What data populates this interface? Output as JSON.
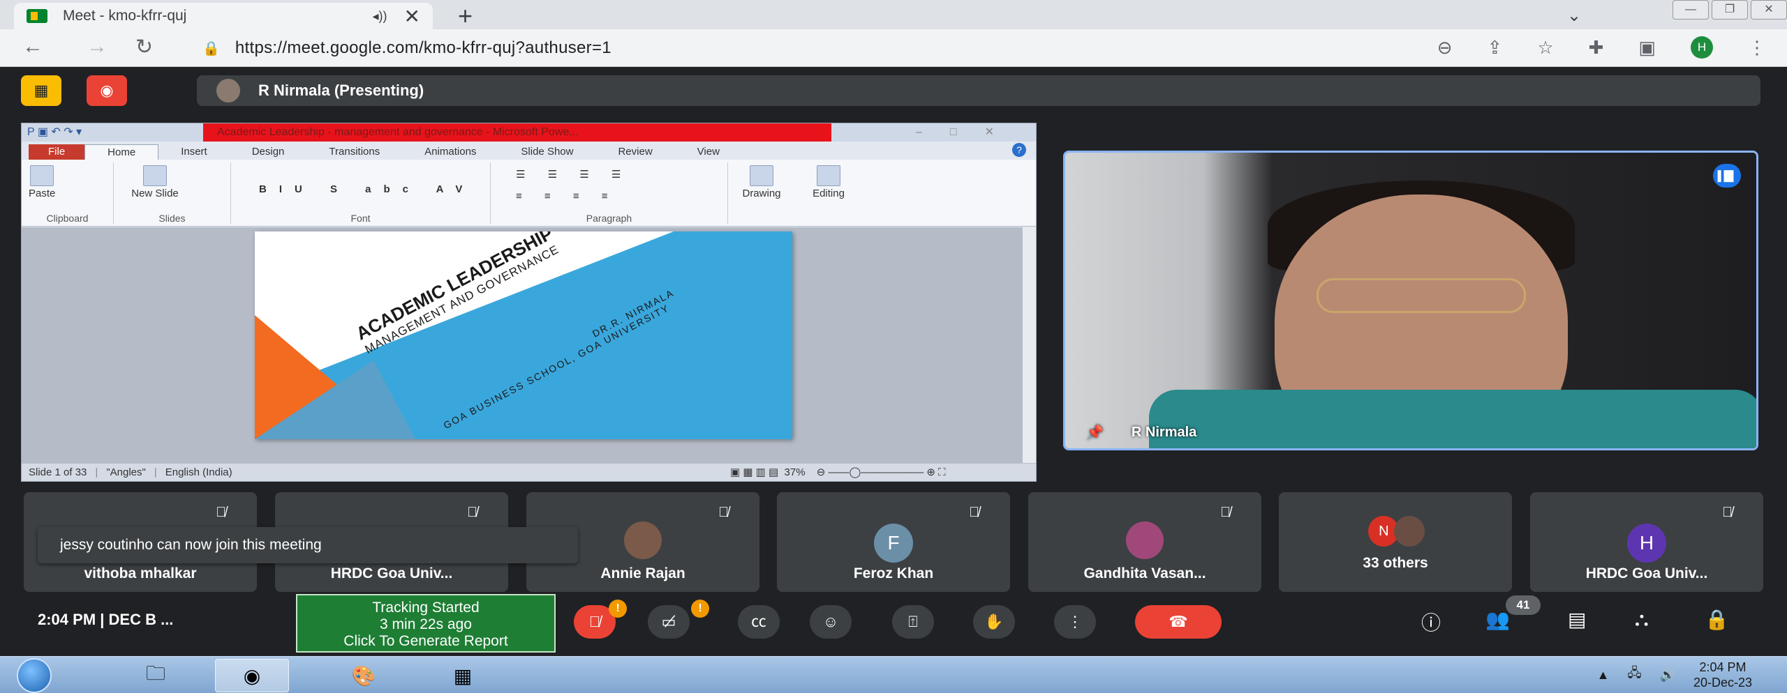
{
  "browser": {
    "tab_title": "Meet - kmo-kfrr-quj",
    "tab_audio_icon": "speaker-icon",
    "tab_close": "✕",
    "new_tab": "+",
    "url": "https://meet.google.com/kmo-kfrr-quj?authuser=1",
    "profile_initial": "H"
  },
  "meet": {
    "presenting_label": "R Nirmala (Presenting)",
    "speaker_name": "R Nirmala",
    "toast": "jessy coutinho can now join this meeting",
    "clock": "2:04 PM  |  DEC B ...",
    "tracking": {
      "line1": "Tracking Started",
      "line2": "3 min 22s ago",
      "line3": "Click To Generate Report"
    },
    "participant_count": "41",
    "participants": [
      {
        "name": "vithoba mhalkar"
      },
      {
        "name": "HRDC Goa Univ..."
      },
      {
        "name": "Annie Rajan"
      },
      {
        "name": "Feroz Khan",
        "initial": "F",
        "color": "#6c8fa8"
      },
      {
        "name": "Gandhita Vasan..."
      },
      {
        "name": "33 others",
        "initial": "N",
        "color": "#d93025"
      },
      {
        "name": "HRDC Goa Univ...",
        "initial": "H",
        "color": "#5e35b1"
      }
    ],
    "badge_mark": "!"
  },
  "ppt": {
    "window_title": "Academic Leadership - management and governance - Microsoft Powe...",
    "tabs": [
      "File",
      "Home",
      "Insert",
      "Design",
      "Transitions",
      "Animations",
      "Slide Show",
      "Review",
      "View"
    ],
    "ribbon": {
      "paste": "Paste",
      "new_slide": "New Slide",
      "drawing": "Drawing",
      "editing": "Editing",
      "groups": [
        "Clipboard",
        "Slides",
        "Font",
        "Paragraph"
      ]
    },
    "slide": {
      "title": "ACADEMIC LEADERSHIP",
      "subtitle": "MANAGEMENT AND GOVERNANCE",
      "author": "DR.R. NIRMALA",
      "affiliation": "GOA BUSINESS SCHOOL, GOA UNIVERSITY"
    },
    "status": {
      "slide_num": "Slide 1 of 33",
      "theme": "\"Angles\"",
      "language": "English (India)",
      "zoom": "37%"
    }
  },
  "taskbar": {
    "time": "2:04 PM",
    "date": "20-Dec-23"
  },
  "colors": {
    "meet_bg": "#202124",
    "tile_bg": "#3c4043",
    "end_call": "#ea4335",
    "slide_blue": "#3aa7dc",
    "slide_orange": "#f26b21",
    "tracking_green": "#1e7e34"
  }
}
